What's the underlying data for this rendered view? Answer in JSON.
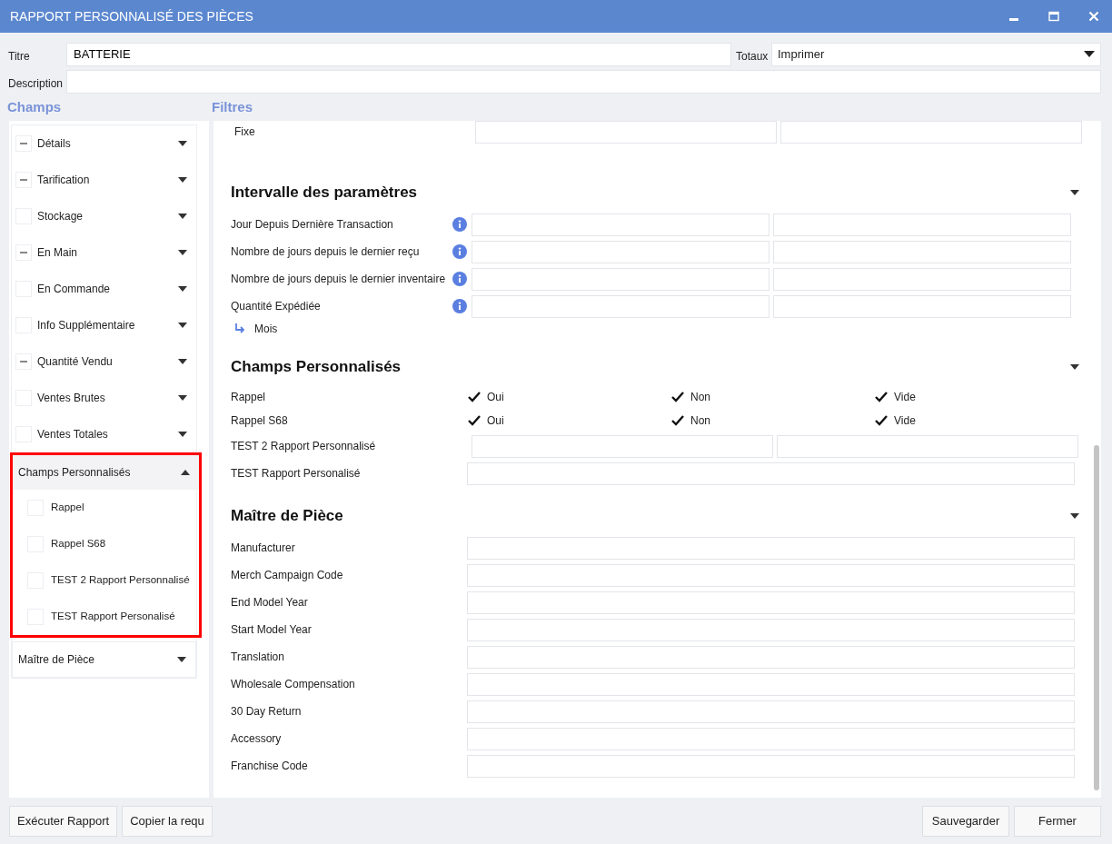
{
  "window": {
    "title": "RAPPORT PERSONNALISÉ DES PIÈCES"
  },
  "form": {
    "title_label": "Titre",
    "title_value": "BATTERIE",
    "totals_label": "Totaux",
    "totals_value": "Imprimer",
    "description_label": "Description"
  },
  "fields_header": "Champs",
  "filters_header": "Filtres",
  "field_groups": [
    {
      "kind": "checkbox",
      "label": "Détails",
      "partial": true,
      "expanded": false
    },
    {
      "kind": "checkbox",
      "label": "Tarification",
      "partial": true,
      "expanded": false
    },
    {
      "kind": "checkbox",
      "label": "Stockage",
      "partial": false,
      "expanded": false
    },
    {
      "kind": "checkbox",
      "label": "En Main",
      "partial": true,
      "expanded": false
    },
    {
      "kind": "checkbox",
      "label": "En Commande",
      "partial": false,
      "expanded": false
    },
    {
      "kind": "checkbox",
      "label": "Info Supplémentaire",
      "partial": false,
      "expanded": false
    },
    {
      "kind": "checkbox",
      "label": "Quantité Vendu",
      "partial": true,
      "expanded": false
    },
    {
      "kind": "checkbox",
      "label": "Ventes Brutes",
      "partial": false,
      "expanded": false
    },
    {
      "kind": "checkbox",
      "label": "Ventes Totales",
      "partial": false,
      "expanded": false
    },
    {
      "kind": "group",
      "label": "Champs Personnalisés",
      "expanded": true,
      "highlighted": true,
      "children": [
        {
          "label": "Rappel",
          "checked": false
        },
        {
          "label": "Rappel S68",
          "checked": false
        },
        {
          "label": "TEST 2 Rapport Personnalisé",
          "checked": false
        },
        {
          "label": "TEST Rapport Personalisé",
          "checked": false
        }
      ]
    },
    {
      "kind": "group",
      "label": "Maître de Pièce",
      "expanded": false
    }
  ],
  "filter_sections": [
    {
      "rows": [
        {
          "kind": "range",
          "label": "Fixe",
          "info": false
        }
      ]
    },
    {
      "title": "Intervalle des paramètres",
      "expanded": true,
      "rows": [
        {
          "kind": "range",
          "label": "Jour Depuis Dernière Transaction",
          "info": true
        },
        {
          "kind": "range",
          "label": "Nombre de jours depuis le dernier reçu",
          "info": true
        },
        {
          "kind": "range",
          "label": "Nombre de jours depuis le dernier inventaire",
          "info": true
        },
        {
          "kind": "range",
          "label": "Quantité Expédiée",
          "info": true
        },
        {
          "kind": "sub",
          "label": "Mois"
        }
      ]
    },
    {
      "title": "Champs Personnalisés",
      "expanded": true,
      "rows": [
        {
          "kind": "checks",
          "label": "Rappel",
          "options": [
            {
              "label": "Oui",
              "checked": true
            },
            {
              "label": "Non",
              "checked": true
            },
            {
              "label": "Vide",
              "checked": true
            }
          ]
        },
        {
          "kind": "checks",
          "label": "Rappel S68",
          "options": [
            {
              "label": "Oui",
              "checked": true
            },
            {
              "label": "Non",
              "checked": true
            },
            {
              "label": "Vide",
              "checked": true
            }
          ]
        },
        {
          "kind": "range",
          "label": "TEST 2 Rapport Personnalisé",
          "info": false
        },
        {
          "kind": "single",
          "label": "TEST Rapport Personalisé"
        }
      ]
    },
    {
      "title": "Maître de Pièce",
      "expanded": true,
      "rows": [
        {
          "kind": "single",
          "label": "Manufacturer"
        },
        {
          "kind": "single",
          "label": "Merch Campaign Code"
        },
        {
          "kind": "single",
          "label": "End Model Year"
        },
        {
          "kind": "single",
          "label": "Start Model Year"
        },
        {
          "kind": "single",
          "label": "Translation"
        },
        {
          "kind": "single",
          "label": "Wholesale Compensation"
        },
        {
          "kind": "single",
          "label": "30 Day Return"
        },
        {
          "kind": "single",
          "label": "Accessory"
        },
        {
          "kind": "single",
          "label": "Franchise Code"
        }
      ]
    }
  ],
  "buttons_left": [
    "Exécuter Rapport",
    "Copier la requ"
  ],
  "buttons_right": [
    "Sauvegarder",
    "Fermer"
  ]
}
